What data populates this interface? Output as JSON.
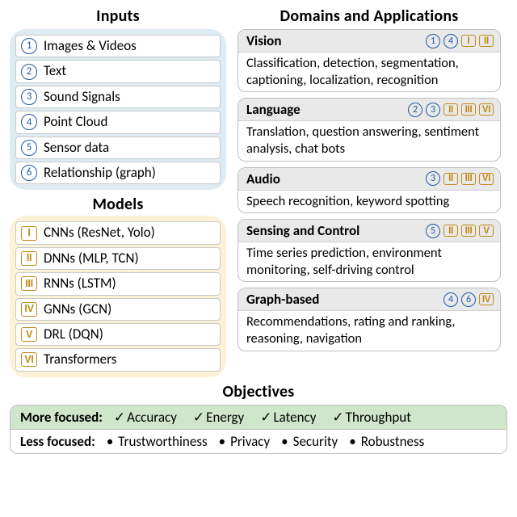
{
  "titles": {
    "inputs": "Inputs",
    "models": "Models",
    "domains": "Domains and Applications",
    "objectives": "Objectives"
  },
  "inputs": [
    {
      "num": "1",
      "label": "Images & Videos"
    },
    {
      "num": "2",
      "label": "Text"
    },
    {
      "num": "3",
      "label": "Sound Signals"
    },
    {
      "num": "4",
      "label": "Point Cloud"
    },
    {
      "num": "5",
      "label": "Sensor data"
    },
    {
      "num": "6",
      "label": "Relationship (graph)"
    }
  ],
  "models": [
    {
      "rom": "I",
      "label": "CNNs (ResNet, Yolo)"
    },
    {
      "rom": "II",
      "label": "DNNs (MLP, TCN)"
    },
    {
      "rom": "III",
      "label": "RNNs (LSTM)"
    },
    {
      "rom": "IV",
      "label": "GNNs (GCN)"
    },
    {
      "rom": "V",
      "label": "DRL (DQN)"
    },
    {
      "rom": "VI",
      "label": "Transformers"
    }
  ],
  "domains": [
    {
      "name": "Vision",
      "inputs": [
        "1",
        "4"
      ],
      "models": [
        "I",
        "II"
      ],
      "body": "Classification, detection, segmentation, captioning, localization, recognition"
    },
    {
      "name": "Language",
      "inputs": [
        "2",
        "3"
      ],
      "models": [
        "II",
        "III",
        "VI"
      ],
      "body": "Translation, question answering, sentiment analysis, chat bots"
    },
    {
      "name": "Audio",
      "inputs": [
        "3"
      ],
      "models": [
        "II",
        "III",
        "VI"
      ],
      "body": "Speech recognition, keyword spotting"
    },
    {
      "name": "Sensing and Control",
      "inputs": [
        "5"
      ],
      "models": [
        "II",
        "III",
        "V"
      ],
      "body": "Time series prediction, environment monitoring, self-driving control"
    },
    {
      "name": "Graph-based",
      "inputs": [
        "4",
        "6"
      ],
      "models": [
        "IV"
      ],
      "body": "Recommendations, rating and ranking, reasoning, navigation"
    }
  ],
  "objectives": {
    "more_label": "More focused:",
    "more": [
      "Accuracy",
      "Energy",
      "Latency",
      "Throughput"
    ],
    "less_label": "Less focused:",
    "less": [
      "Trustworthiness",
      "Privacy",
      "Security",
      "Robustness"
    ]
  }
}
